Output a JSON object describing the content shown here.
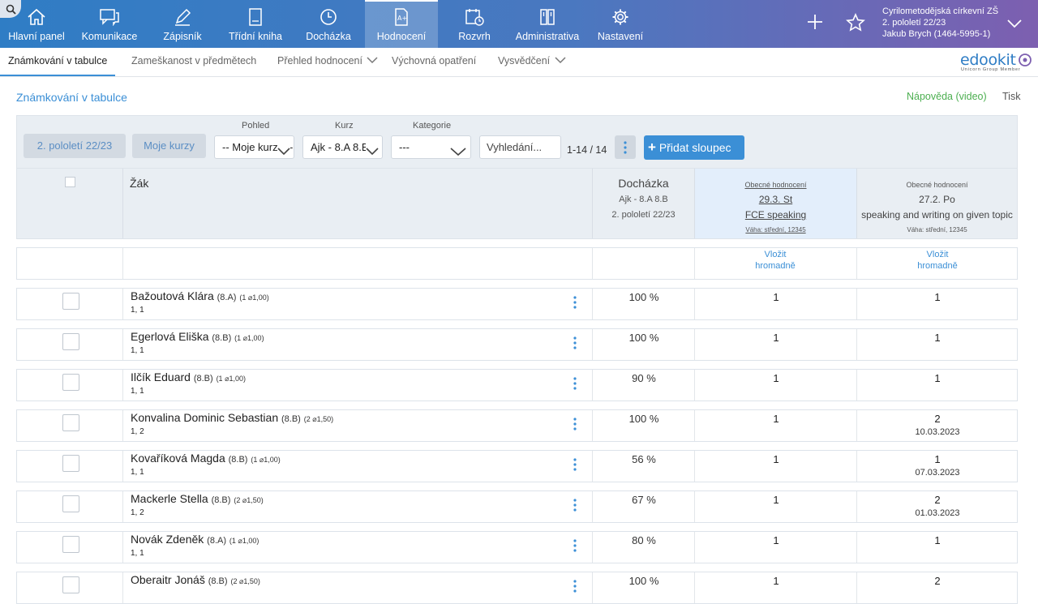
{
  "topnav": {
    "items": [
      {
        "label": "Hlavní panel",
        "icon": "home-icon"
      },
      {
        "label": "Komunikace",
        "icon": "chat-icon"
      },
      {
        "label": "Zápisník",
        "icon": "pencil-icon"
      },
      {
        "label": "Třídní kniha",
        "icon": "book-icon"
      },
      {
        "label": "Docházka",
        "icon": "clock-icon"
      },
      {
        "label": "Hodnocení",
        "icon": "grade-document-icon"
      },
      {
        "label": "Rozvrh",
        "icon": "schedule-icon"
      },
      {
        "label": "Administrativa",
        "icon": "binders-icon"
      },
      {
        "label": "Nastavení",
        "icon": "gear-icon"
      }
    ],
    "school": "Cyrilometodějská církevní ZŠ",
    "term": "2. pololetí 22/23",
    "user": "Jakub Brych (1464-5995-1)"
  },
  "subnav": {
    "items": [
      {
        "label": "Známkování v tabulce"
      },
      {
        "label": "Zameškanost v předmětech"
      },
      {
        "label": "Přehled hodnocení"
      },
      {
        "label": "Výchovná opatření"
      },
      {
        "label": "Vysvědčení"
      }
    ],
    "logo": "edookit",
    "logo_sub": "Unicorn Group Member"
  },
  "page": {
    "title": "Známkování v tabulce",
    "help": "Nápověda (video)",
    "print": "Tisk"
  },
  "filters": {
    "term_button": "2. pololetí 22/23",
    "my_courses_button": "Moje kurzy",
    "view_label": "Pohled",
    "view_value": "-- Moje kurzy --",
    "course_label": "Kurz",
    "course_value": "Ajk - 8.A 8.B",
    "category_label": "Kategorie",
    "category_value": "---",
    "search_placeholder": "Vyhledání...",
    "count": "1-14 / 14",
    "add_column": "Přidat sloupec"
  },
  "table": {
    "student_header": "Žák",
    "attendance": {
      "title": "Docházka",
      "course": "Ajk - 8.A 8.B",
      "term": "2. pololetí 22/23"
    },
    "columns": [
      {
        "category": "Obecné hodnocení",
        "date": "29.3. St",
        "topic": "FCE speaking",
        "weight": "Váha: střední, 12345"
      },
      {
        "category": "Obecné hodnocení",
        "date": "27.2. Po",
        "topic": "speaking and writing on given topic",
        "weight": "Váha: střední, 12345"
      }
    ],
    "bulk_label_line1": "Vložit",
    "bulk_label_line2": "hromadně",
    "students": [
      {
        "name": "Bažoutová Klára",
        "class": "(8.A)",
        "avg": "(1 ⌀1,00)",
        "grades": "1, 1",
        "attendance": "100 %",
        "g1": "1",
        "g2": "1",
        "g2_date": ""
      },
      {
        "name": "Egerlová Eliška",
        "class": "(8.B)",
        "avg": "(1 ⌀1,00)",
        "grades": "1, 1",
        "attendance": "100 %",
        "g1": "1",
        "g2": "1",
        "g2_date": ""
      },
      {
        "name": "Ilčík Eduard",
        "class": "(8.B)",
        "avg": "(1 ⌀1,00)",
        "grades": "1, 1",
        "attendance": "90 %",
        "g1": "1",
        "g2": "1",
        "g2_date": ""
      },
      {
        "name": "Konvalina Dominic Sebastian",
        "class": "(8.B)",
        "avg": "(2 ⌀1,50)",
        "grades": "1, 2",
        "attendance": "100 %",
        "g1": "1",
        "g2": "2",
        "g2_date": "10.03.2023"
      },
      {
        "name": "Kovaříková Magda",
        "class": "(8.B)",
        "avg": "(1 ⌀1,00)",
        "grades": "1, 1",
        "attendance": "56 %",
        "g1": "1",
        "g2": "1",
        "g2_date": "07.03.2023"
      },
      {
        "name": "Mackerle Stella",
        "class": "(8.B)",
        "avg": "(2 ⌀1,50)",
        "grades": "1, 2",
        "attendance": "67 %",
        "g1": "1",
        "g2": "2",
        "g2_date": "01.03.2023"
      },
      {
        "name": "Novák Zdeněk",
        "class": "(8.A)",
        "avg": "(1 ⌀1,00)",
        "grades": "1, 1",
        "attendance": "80 %",
        "g1": "1",
        "g2": "1",
        "g2_date": ""
      },
      {
        "name": "Oberaitr Jonáš",
        "class": "(8.B)",
        "avg": "(2 ⌀1,50)",
        "grades": "",
        "attendance": "100 %",
        "g1": "1",
        "g2": "2",
        "g2_date": ""
      }
    ]
  },
  "colors": {
    "accent": "#3b8fd6",
    "help_green": "#4caf50",
    "nav_start": "#2f7dc5",
    "nav_end": "#7d5fb0"
  }
}
